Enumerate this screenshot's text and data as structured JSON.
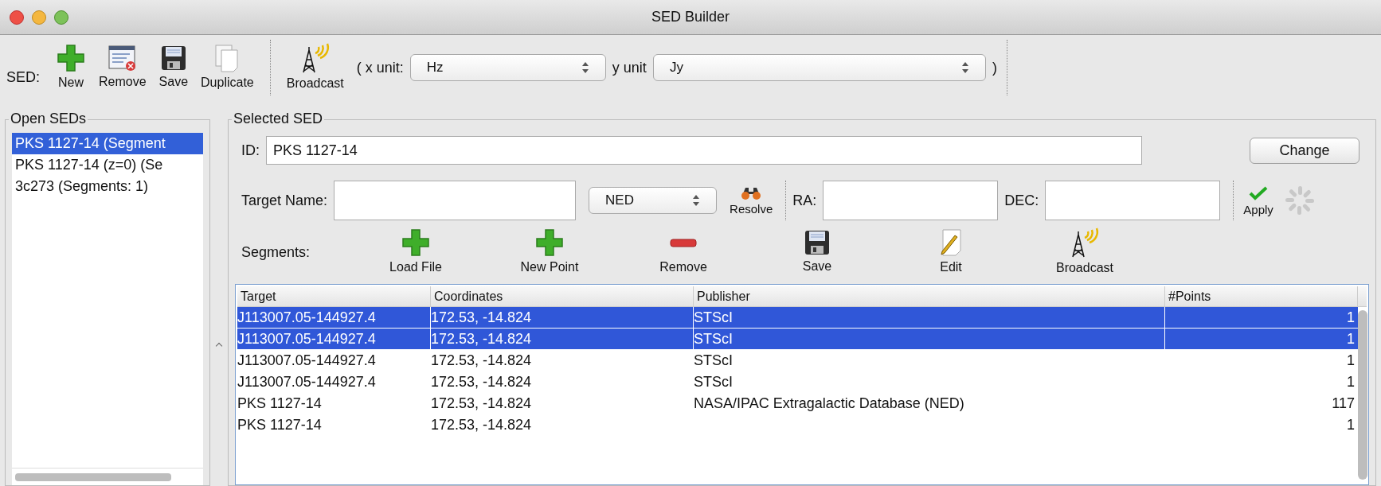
{
  "window": {
    "title": "SED Builder"
  },
  "toolbar": {
    "label": "SED:",
    "sed_buttons": [
      {
        "label": "New"
      },
      {
        "label": "Remove"
      },
      {
        "label": "Save"
      },
      {
        "label": "Duplicate"
      }
    ],
    "broadcast_button": {
      "label": "Broadcast"
    },
    "x_unit": {
      "label": "( x unit:",
      "value": "Hz"
    },
    "y_unit": {
      "label": "y unit",
      "value": "Jy"
    },
    "closing": ")"
  },
  "open_seds": {
    "title": "Open SEDs",
    "items": [
      {
        "label": "PKS 1127-14 (Segment",
        "selected": true
      },
      {
        "label": "PKS 1127-14 (z=0) (Se",
        "selected": false
      },
      {
        "label": "3c273 (Segments: 1)",
        "selected": false
      }
    ]
  },
  "selected_sed": {
    "title": "Selected SED",
    "id": {
      "label": "ID:",
      "value": "PKS 1127-14"
    },
    "change_button": "Change",
    "target_name": {
      "label": "Target Name:"
    },
    "resolver": {
      "value": "NED"
    },
    "resolve_button": "Resolve",
    "ra": {
      "label": "RA:"
    },
    "dec": {
      "label": "DEC:"
    },
    "apply_button": "Apply",
    "segments": {
      "label": "Segments:",
      "buttons": [
        {
          "label": "Load File"
        },
        {
          "label": "New Point"
        },
        {
          "label": "Remove"
        },
        {
          "label": "Save"
        },
        {
          "label": "Edit"
        },
        {
          "label": "Broadcast"
        }
      ]
    }
  },
  "table": {
    "columns": [
      "Target",
      "Coordinates",
      "Publisher",
      "#Points"
    ],
    "rows": [
      {
        "selected": true,
        "target": "J113007.05-144927.4",
        "coordinates": "172.53, -14.824",
        "publisher": "STScI",
        "points": "1"
      },
      {
        "selected": true,
        "target": "J113007.05-144927.4",
        "coordinates": "172.53, -14.824",
        "publisher": "STScI",
        "points": "1"
      },
      {
        "selected": false,
        "target": "J113007.05-144927.4",
        "coordinates": "172.53, -14.824",
        "publisher": "STScI",
        "points": "1"
      },
      {
        "selected": false,
        "target": "J113007.05-144927.4",
        "coordinates": "172.53, -14.824",
        "publisher": "STScI",
        "points": "1"
      },
      {
        "selected": false,
        "target": "PKS 1127-14",
        "coordinates": "172.53, -14.824",
        "publisher": "NASA/IPAC Extragalactic Database (NED)",
        "points": "117"
      },
      {
        "selected": false,
        "target": "PKS 1127-14",
        "coordinates": "172.53, -14.824",
        "points": "1"
      }
    ]
  }
}
